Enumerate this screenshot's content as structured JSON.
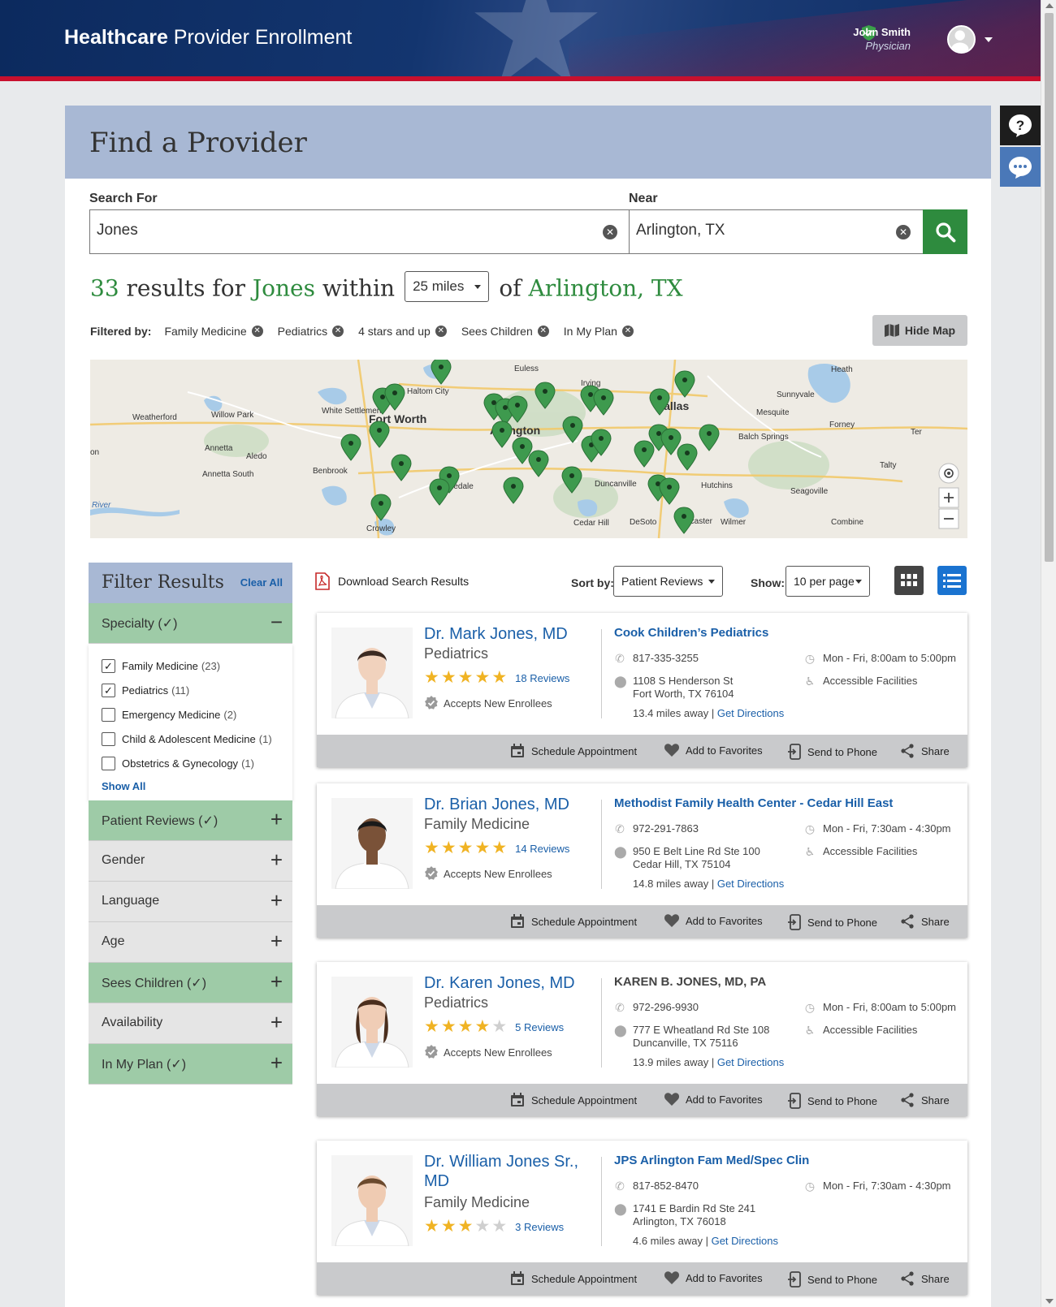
{
  "header": {
    "brand_bold": "Healthcare",
    "brand_rest": " Provider Enrollment",
    "user_name": "John Smith",
    "user_role": "Physician"
  },
  "page_title": "Find a Provider",
  "search": {
    "for_label": "Search For",
    "for_value": "Jones",
    "near_label": "Near",
    "near_value": "Arlington, TX"
  },
  "results": {
    "count": "33",
    "text1": " results for ",
    "term": "Jones",
    "text2": " within",
    "radius": "25 miles",
    "text3": "of ",
    "location": "Arlington, TX"
  },
  "filters": {
    "label": "Filtered by:",
    "chips": [
      "Family Medicine",
      "Pediatrics",
      "4 stars and up",
      "Sees Children",
      "In My Plan"
    ],
    "hide_map": "Hide Map"
  },
  "map_labels": [
    "Euless",
    "Irving",
    "Heath",
    "Haltom City",
    "Sunnyvale",
    "Weatherford",
    "Willow Park",
    "White Settlement",
    "Fort Worth",
    "Dallas",
    "Mesquite",
    "Forney",
    "Arlington",
    "Balch Springs",
    "Ter",
    "Annetta",
    "Aledo",
    "Talty",
    "on",
    "Annetta South",
    "Benbrook",
    "Kennedale",
    "Duncanville",
    "Hutchins",
    "Seagoville",
    "River",
    "Crowley",
    "Cedar Hill",
    "DeSoto",
    "Lancaster",
    "Wilmer",
    "Combine"
  ],
  "filter_panel": {
    "title": "Filter Results",
    "clear": "Clear All",
    "sections": [
      {
        "label": "Specialty",
        "checked": true,
        "expanded": true
      },
      {
        "label": "Patient Reviews",
        "checked": true,
        "expanded": false
      },
      {
        "label": "Gender",
        "checked": false,
        "expanded": false
      },
      {
        "label": "Language",
        "checked": false,
        "expanded": false
      },
      {
        "label": "Age",
        "checked": false,
        "expanded": false
      },
      {
        "label": "Sees Children",
        "checked": true,
        "expanded": false
      },
      {
        "label": "Availability",
        "checked": false,
        "expanded": false
      },
      {
        "label": "In My Plan",
        "checked": true,
        "expanded": false
      }
    ],
    "specialties": [
      {
        "label": "Family Medicine",
        "count": "(23)",
        "checked": true
      },
      {
        "label": "Pediatrics",
        "count": "(11)",
        "checked": true
      },
      {
        "label": "Emergency Medicine",
        "count": "(2)",
        "checked": false
      },
      {
        "label": "Child & Adolescent Medicine",
        "count": "(1)",
        "checked": false
      },
      {
        "label": "Obstetrics & Gynecology",
        "count": "(1)",
        "checked": false
      }
    ],
    "show_all": "Show All"
  },
  "toolbar": {
    "download": "Download Search Results",
    "sort_label": "Sort by:",
    "sort_value": "Patient Reviews",
    "show_label": "Show:",
    "show_value": "10 per page"
  },
  "providers": [
    {
      "name": "Dr. Mark Jones, MD",
      "specialty": "Pediatrics",
      "rating": 5,
      "reviews": "18 Reviews",
      "accepts": "Accepts New Enrollees",
      "clinic": "Cook Children’s Pediatrics",
      "clinic_link": true,
      "phone": "817-335-3255",
      "addr1": "1108 S Henderson St",
      "addr2": "Fort Worth, TX 76104",
      "distance": "13.4 miles away",
      "directions": "Get Directions",
      "hours": "Mon - Fri, 8:00am to 5:00pm",
      "accessible": "Accessible Facilities"
    },
    {
      "name": "Dr. Brian Jones, MD",
      "specialty": "Family Medicine",
      "rating": 5,
      "reviews": "14 Reviews",
      "accepts": "Accepts New Enrollees",
      "clinic": "Methodist Family Health Center - Cedar Hill East",
      "clinic_link": true,
      "phone": "972-291-7863",
      "addr1": "950 E Belt Line Rd Ste 100",
      "addr2": "Cedar Hill, TX 75104",
      "distance": "14.8 miles away",
      "directions": "Get Directions",
      "hours": "Mon - Fri, 7:30am - 4:30pm",
      "accessible": "Accessible Facilities"
    },
    {
      "name": "Dr. Karen Jones, MD",
      "specialty": "Pediatrics",
      "rating": 4,
      "reviews": "5 Reviews",
      "accepts": "Accepts New Enrollees",
      "clinic": "KAREN B. JONES, MD, PA",
      "clinic_link": false,
      "phone": "972-296-9930",
      "addr1": "777 E Wheatland Rd Ste 108",
      "addr2": "Duncanville, TX 75116",
      "distance": "13.9 miles away",
      "directions": "Get Directions",
      "hours": "Mon - Fri, 8:00am to 5:00pm",
      "accessible": "Accessible Facilities"
    },
    {
      "name": "Dr. William Jones Sr., MD",
      "specialty": "Family Medicine",
      "rating": 3,
      "reviews": "3 Reviews",
      "accepts": "",
      "clinic": "JPS Arlington Fam Med/Spec Clin",
      "clinic_link": true,
      "phone": "817-852-8470",
      "addr1": "1741 E Bardin Rd Ste 241",
      "addr2": "Arlington, TX 76018",
      "distance": "4.6 miles away",
      "directions": "Get Directions",
      "hours": "Mon - Fri, 7:30am - 4:30pm",
      "accessible": ""
    }
  ],
  "card_actions": {
    "schedule": "Schedule Appointment",
    "favorites": "Add to Favorites",
    "phone": "Send to Phone",
    "share": "Share"
  },
  "colors": {
    "header_navy": "#0c2a5e",
    "accent_red": "#c8102e",
    "green": "#2e8b3e",
    "link_blue": "#1a5fa8",
    "banner": "#a8b8d4"
  }
}
